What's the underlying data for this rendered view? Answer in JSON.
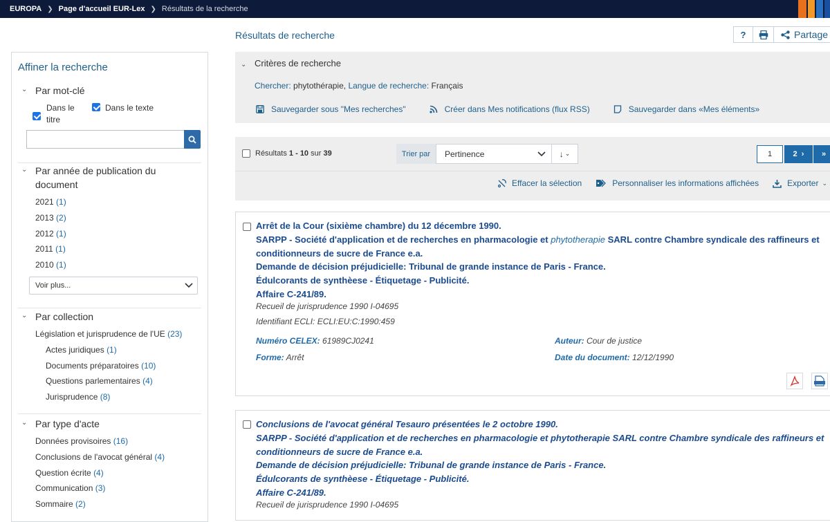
{
  "breadcrumb": {
    "items": [
      {
        "label": "EUROPA"
      },
      {
        "label": "Page d'accueil EUR-Lex"
      },
      {
        "label": "Résultats de la recherche"
      }
    ]
  },
  "header": {
    "title": "Résultats de recherche",
    "help_label": "?",
    "share_label": "Partage"
  },
  "sidebar": {
    "title": "Affiner la recherche",
    "keyword": {
      "heading": "Par mot-clé",
      "checkbox_title": "Dans le titre",
      "checkbox_text": "Dans le texte",
      "input_value": ""
    },
    "year": {
      "heading": "Par année de publication du document",
      "items": [
        {
          "label": "2021",
          "count": "(1)"
        },
        {
          "label": "2013",
          "count": "(2)"
        },
        {
          "label": "2012",
          "count": "(1)"
        },
        {
          "label": "2011",
          "count": "(1)"
        },
        {
          "label": "2010",
          "count": "(1)"
        }
      ],
      "more_label": "Voir plus..."
    },
    "collection": {
      "heading": "Par collection",
      "items": [
        {
          "label": "Législation et jurisprudence de l'UE",
          "count": "(23)"
        },
        {
          "label": "Actes juridiques",
          "count": "(1)"
        },
        {
          "label": "Documents préparatoires",
          "count": "(10)"
        },
        {
          "label": "Questions parlementaires",
          "count": "(4)"
        },
        {
          "label": "Jurisprudence",
          "count": "(8)"
        }
      ]
    },
    "type": {
      "heading": "Par type d'acte",
      "items": [
        {
          "label": "Données provisoires",
          "count": "(16)"
        },
        {
          "label": "Conclusions de l'avocat général",
          "count": "(4)"
        },
        {
          "label": "Question écrite",
          "count": "(4)"
        },
        {
          "label": "Communication",
          "count": "(3)"
        },
        {
          "label": "Sommaire",
          "count": "(2)"
        }
      ]
    }
  },
  "criteria": {
    "heading": "Critères de recherche",
    "search_label": "Chercher:",
    "search_value": "phytothérapie,",
    "lang_label": "Langue de recherche:",
    "lang_value": "Français",
    "links": {
      "save_search": "Sauvegarder sous \"Mes recherches\"",
      "notify": "Créer dans Mes notifications (flux RSS)",
      "save_items": "Sauvegarder dans «Mes éléments»"
    }
  },
  "results_bar": {
    "results_prefix": "Résultats",
    "range": "1 - 10",
    "of": "sur",
    "total": "39",
    "sort_label": "Trier par",
    "sort_value": "Pertinence",
    "sort_direction": "↓",
    "page_current": "1",
    "page_next": "2",
    "clear_selection": "Effacer la sélection",
    "customize": "Personnaliser les informations affichées",
    "export": "Exporter"
  },
  "results": [
    {
      "line1": "Arrêt de la Cour (sixième chambre) du 12 décembre 1990.",
      "line2a": "SARPP - Société d'application et de recherches en pharmacologie et",
      "line2hl": "phytotherapie",
      "line2b": "SARL contre Chambre syndicale des raffineurs et conditionneurs de sucre de France e.a.",
      "line3": "Demande de décision préjudicielle: Tribunal de grande instance de Paris - France.",
      "line4": "Édulcorants de synthèese - Étiquetage - Publicité.",
      "line5": "Affaire C-241/89.",
      "recueil": "Recueil de jurisprudence 1990 I-04695",
      "ecli": "Identifiant ECLI: ECLI:EU:C:1990:459",
      "celex_label": "Numéro CELEX:",
      "celex_value": "61989CJ0241",
      "forme_label": "Forme:",
      "forme_value": "Arrêt",
      "auteur_label": "Auteur:",
      "auteur_value": "Cour de justice",
      "date_label": "Date du document:",
      "date_value": "12/12/1990"
    },
    {
      "line1": "Conclusions de l'avocat général Tesauro présentées le 2 octobre 1990.",
      "line2": "SARPP - Société d'application et de recherches en pharmacologie et phytotherapie SARL contre Chambre syndicale des raffineurs et conditionneurs de sucre de France e.a.",
      "line3": "Demande de décision préjudicielle: Tribunal de grande instance de Paris - France.",
      "line4": "Édulcorants de synthèese - Étiquetage - Publicité.",
      "line5": "Affaire C-241/89.",
      "recueil": "Recueil de jurisprudence 1990 I-04695"
    }
  ],
  "colors": {
    "topbar": "#0e1a3a",
    "link": "#1f5f8b",
    "title_blue": "#1b4b8f",
    "button_blue": "#1f6aa8",
    "panel_gray": "#eeeeee"
  }
}
